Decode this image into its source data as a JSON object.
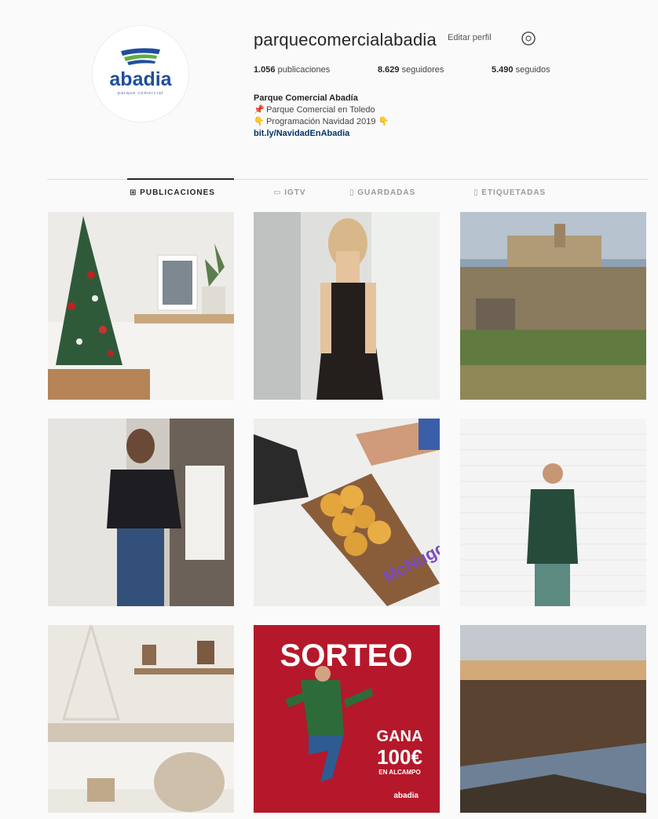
{
  "profile": {
    "username": "parquecomercialabadia",
    "edit_label": "Editar perfil",
    "stats": {
      "posts": "1.056",
      "posts_label": "publicaciones",
      "followers": "8.629",
      "followers_label": "seguidores",
      "following": "5.490",
      "following_label": "seguidos"
    },
    "bio": {
      "name": "Parque Comercial Abadía",
      "line1": "Parque Comercial en Toledo",
      "line2": "Programación Navidad 2019",
      "link": "bit.ly/NavidadEnAbadia"
    },
    "logo_text": "abadia",
    "logo_subtext": "parque comercial"
  },
  "tabs": [
    {
      "label": "PUBLICACIONES",
      "active": true
    },
    {
      "label": "IGTV",
      "active": false
    },
    {
      "label": "GUARDADAS",
      "active": false
    },
    {
      "label": "ETIQUETADAS",
      "active": false
    }
  ],
  "posts": [
    {
      "subject": "christmas-tree-interior"
    },
    {
      "subject": "woman-black-dress"
    },
    {
      "subject": "toledo-alcazar"
    },
    {
      "subject": "woman-dark-sweater"
    },
    {
      "subject": "chicken-nuggets"
    },
    {
      "subject": "man-christmas-sweater"
    },
    {
      "subject": "dining-table-decor"
    },
    {
      "subject": "sorteo-promo"
    },
    {
      "subject": "toledo-panorama"
    }
  ],
  "promo": {
    "title": "SORTEO",
    "gana": "GANA",
    "amount": "100€",
    "where": "EN ALCAMPO",
    "brand": "abadia"
  },
  "nugget_box_text": "McNuggets"
}
